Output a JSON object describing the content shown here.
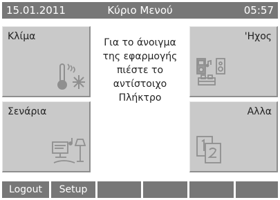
{
  "header": {
    "date": "15.01.2011",
    "title": "Κύριο Μενού",
    "time": "05:57"
  },
  "tiles": {
    "klima": {
      "label": "Κλίμα",
      "icon": "thermometer-snowflake-icon"
    },
    "ichos": {
      "label": "'Ηχος",
      "icon": "audio-system-icon"
    },
    "senaria": {
      "label": "Σενάρια",
      "icon": "scenario-monitor-lamp-icon"
    },
    "alla": {
      "label": "Αλλα",
      "icon": "pages-1-2-icon"
    }
  },
  "message": {
    "lines": [
      "Για το άνοιγμα",
      "της εφαρμογής",
      "πιέστε το",
      "αντίστοιχο",
      "Πλήκτρο"
    ]
  },
  "bottom_bar": {
    "buttons": [
      "Logout",
      "Setup",
      "",
      "",
      "",
      "",
      ""
    ]
  },
  "colors": {
    "header_bg": "#777777",
    "tile_bg": "#c9c9c9",
    "icon_gray": "#8f8f8f"
  }
}
